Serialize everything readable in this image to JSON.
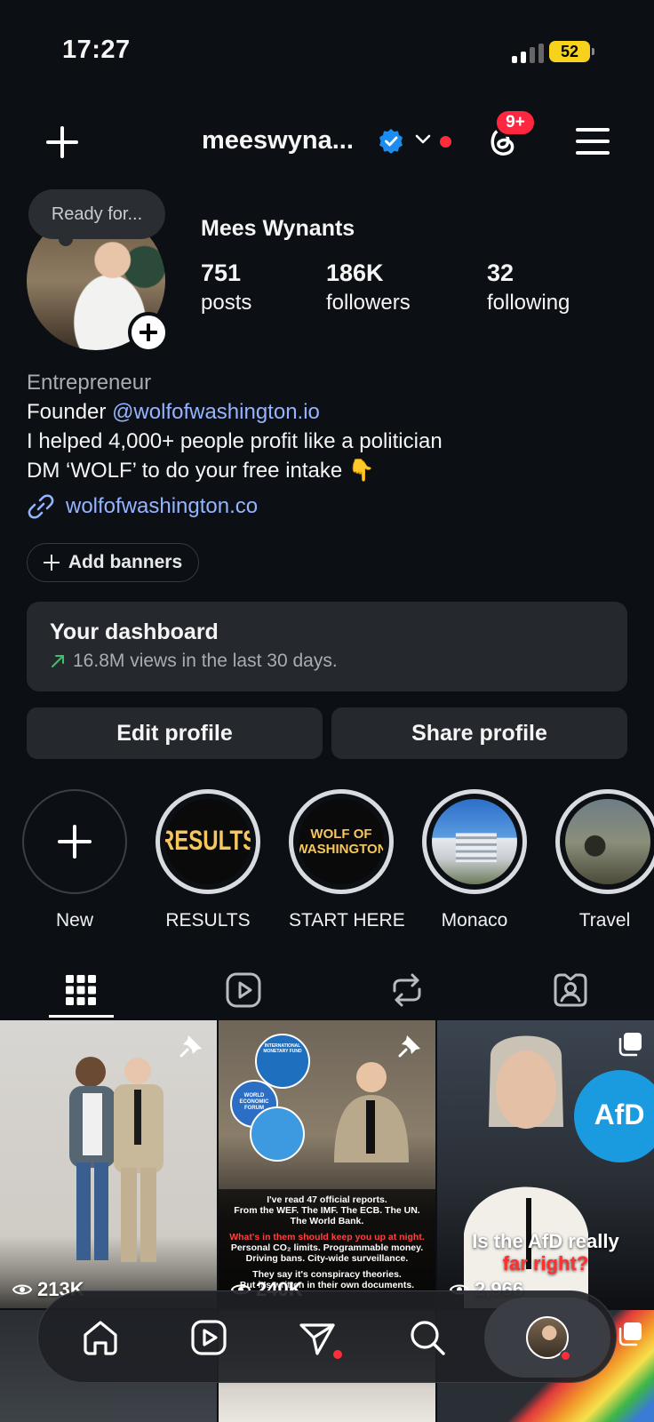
{
  "status_bar": {
    "time": "17:27",
    "battery": "52"
  },
  "header": {
    "username": "meeswyna...",
    "notification_count": "9+"
  },
  "profile": {
    "note": "Ready for...",
    "display_name": "Mees Wynants",
    "stats": [
      {
        "value": "751",
        "label": "posts"
      },
      {
        "value": "186K",
        "label": "followers"
      },
      {
        "value": "32",
        "label": "following"
      }
    ],
    "bio": {
      "category": "Entrepreneur",
      "founder_prefix": "Founder ",
      "mention": "@wolfofwashington.io",
      "line2": "I helped 4,000+ people profit like a politician",
      "line3": "DM ‘WOLF’ to do your free intake 👇"
    },
    "link": "wolfofwashington.co",
    "add_banners": "Add banners"
  },
  "dashboard": {
    "title": "Your dashboard",
    "subtitle": "16.8M views in the last 30 days."
  },
  "buttons": {
    "edit": "Edit profile",
    "share": "Share profile"
  },
  "highlights": [
    {
      "label": "New",
      "cover": ""
    },
    {
      "label": "RESULTS",
      "cover": "RESULTS"
    },
    {
      "label": "START HERE",
      "cover": "WOLF OF WASHINGTON"
    },
    {
      "label": "Monaco",
      "cover": ""
    },
    {
      "label": "Travel",
      "cover": ""
    }
  ],
  "tabs": [
    "grid-icon",
    "reels-icon",
    "reposts-icon",
    "tagged-icon"
  ],
  "grid": [
    {
      "views": "213K",
      "pinned": true
    },
    {
      "views": "240K",
      "pinned": true,
      "lines": [
        "I've read 47 official reports.",
        "From the WEF. The IMF. The ECB. The UN.",
        "The World Bank.",
        "What's in them should keep you up at night.",
        "Personal CO₂ limits. Programmable money.",
        "Driving bans. City-wide surveillance.",
        "They say it's conspiracy theories.",
        "But it's written in their own documents."
      ],
      "logos": [
        "INTERNATIONAL MONETARY FUND",
        "WORLD ECONOMIC FORUM"
      ]
    },
    {
      "views": "2,966",
      "caption_1": "Is the AfD really",
      "caption_2": "far right?",
      "badge": "AfD"
    }
  ],
  "colors": {
    "accent_link": "#95b4ff",
    "badge_red": "#ff2740",
    "verified_blue": "#1d8cf0",
    "trend_green": "#3ac46a"
  }
}
